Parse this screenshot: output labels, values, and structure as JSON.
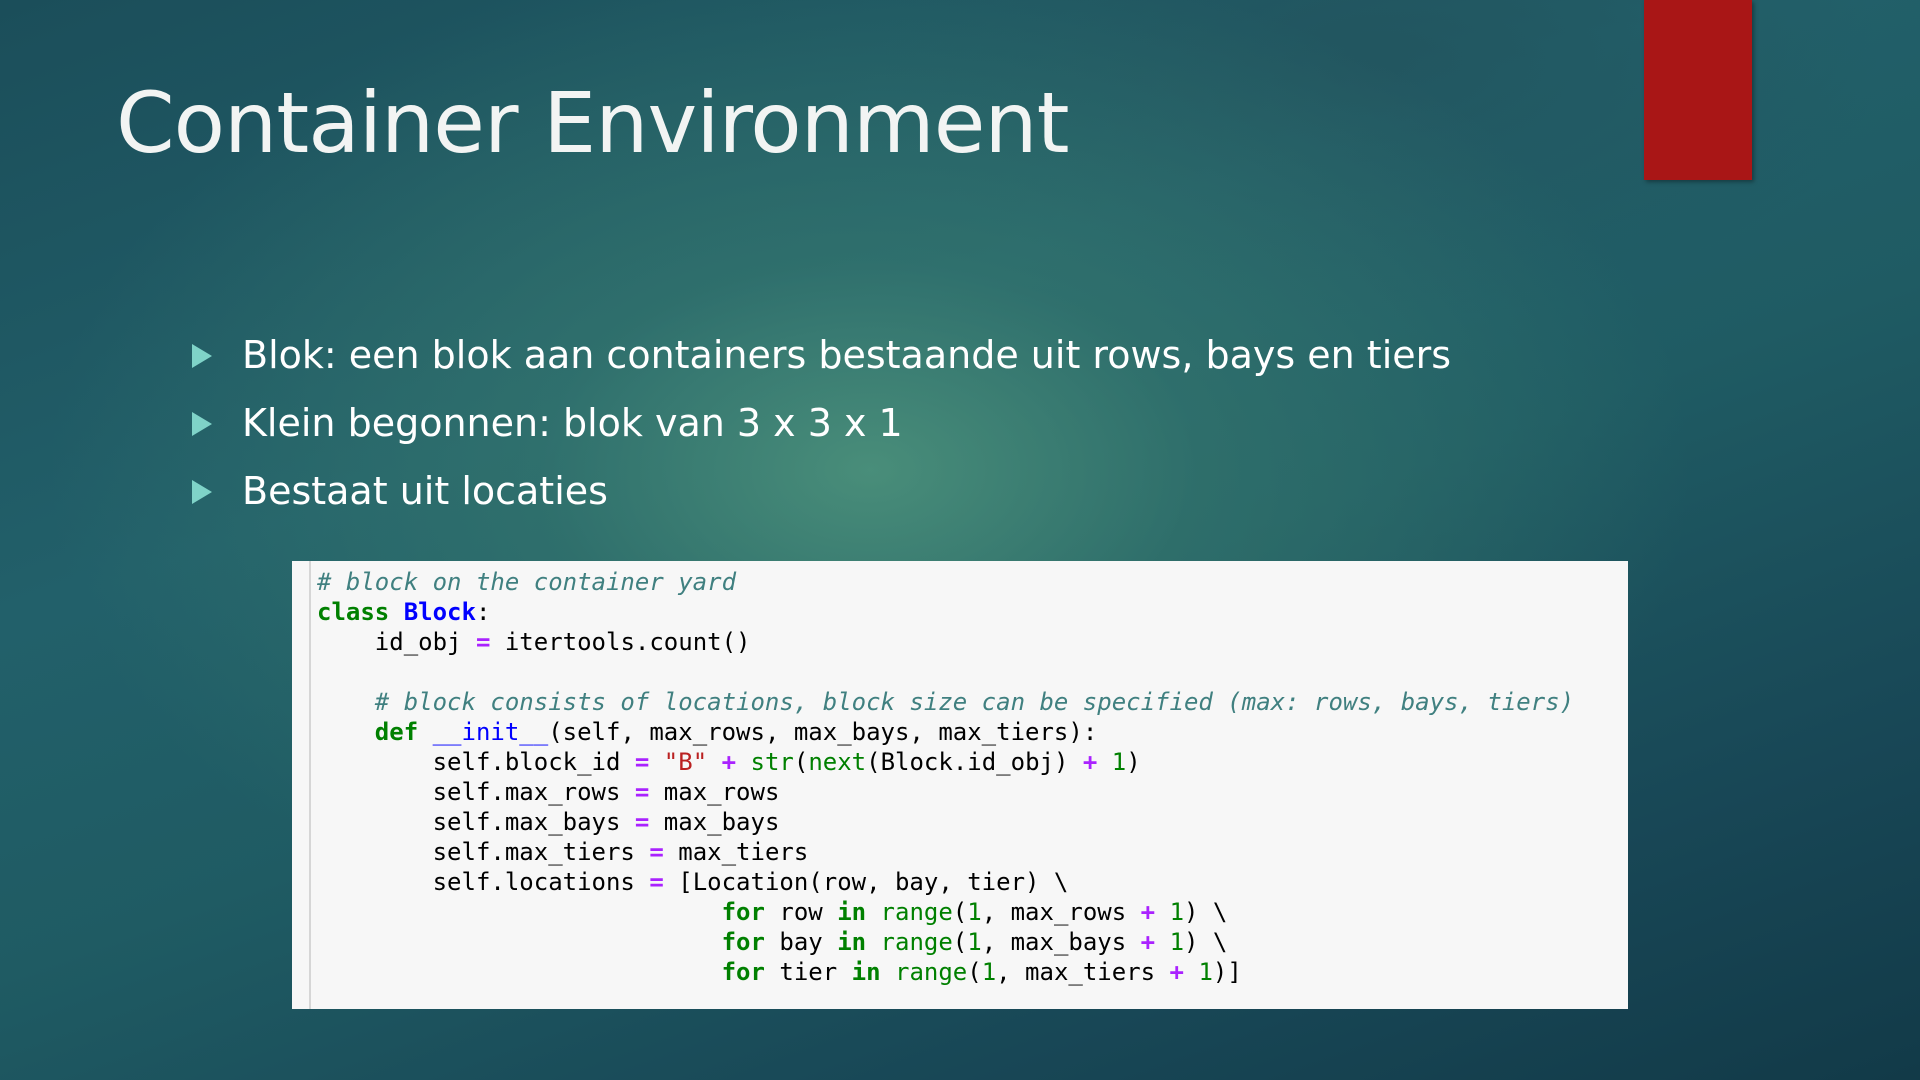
{
  "slide": {
    "title": "Container Environment",
    "accent_color": "#a91616",
    "bullet_color": "#7fd3c8",
    "bullets": [
      "Blok: een blok aan containers bestaande uit rows, bays en tiers",
      "Klein begonnen: blok van 3 x 3 x 1",
      "Bestaat uit locaties"
    ]
  },
  "code": {
    "l1": "# block on the container yard",
    "l2_kw": "class",
    "l2_name": "Block",
    "l2_end": ":",
    "l3_pre": "    id_obj ",
    "l3_op": "=",
    "l3_post": " itertools.count()",
    "l5": "    # block consists of locations, block size can be specified (max: rows, bays, tiers)",
    "l6_pre": "    ",
    "l6_kw": "def",
    "l6_sp": " ",
    "l6_fn": "__init__",
    "l6_post": "(self, max_rows, max_bays, max_tiers):",
    "l7_pre": "        self.block_id ",
    "l7_op1": "=",
    "l7_sp1": " ",
    "l7_str": "\"B\"",
    "l7_sp2": " ",
    "l7_op2": "+",
    "l7_sp3": " ",
    "l7_bi1": "str",
    "l7_p1": "(",
    "l7_bi2": "next",
    "l7_p2": "(Block.id_obj) ",
    "l7_op3": "+",
    "l7_sp4": " ",
    "l7_num": "1",
    "l7_end": ")",
    "l8_pre": "        self.max_rows ",
    "l8_op": "=",
    "l8_post": " max_rows",
    "l9_pre": "        self.max_bays ",
    "l9_op": "=",
    "l9_post": " max_bays",
    "l10_pre": "        self.max_tiers ",
    "l10_op": "=",
    "l10_post": " max_tiers",
    "l11_pre": "        self.locations ",
    "l11_op": "=",
    "l11_post": " [Location(row, bay, tier) \\",
    "l12_pre": "                            ",
    "l12_kw1": "for",
    "l12_a": " row ",
    "l12_kw2": "in",
    "l12_sp": " ",
    "l12_bi": "range",
    "l12_p": "(",
    "l12_num1": "1",
    "l12_b": ", max_rows ",
    "l12_op": "+",
    "l12_sp2": " ",
    "l12_num2": "1",
    "l12_end": ") \\",
    "l13_pre": "                            ",
    "l13_kw1": "for",
    "l13_a": " bay ",
    "l13_kw2": "in",
    "l13_sp": " ",
    "l13_bi": "range",
    "l13_p": "(",
    "l13_num1": "1",
    "l13_b": ", max_bays ",
    "l13_op": "+",
    "l13_sp2": " ",
    "l13_num2": "1",
    "l13_end": ") \\",
    "l14_pre": "                            ",
    "l14_kw1": "for",
    "l14_a": " tier ",
    "l14_kw2": "in",
    "l14_sp": " ",
    "l14_bi": "range",
    "l14_p": "(",
    "l14_num1": "1",
    "l14_b": ", max_tiers ",
    "l14_op": "+",
    "l14_sp2": " ",
    "l14_num2": "1",
    "l14_end": ")]"
  }
}
